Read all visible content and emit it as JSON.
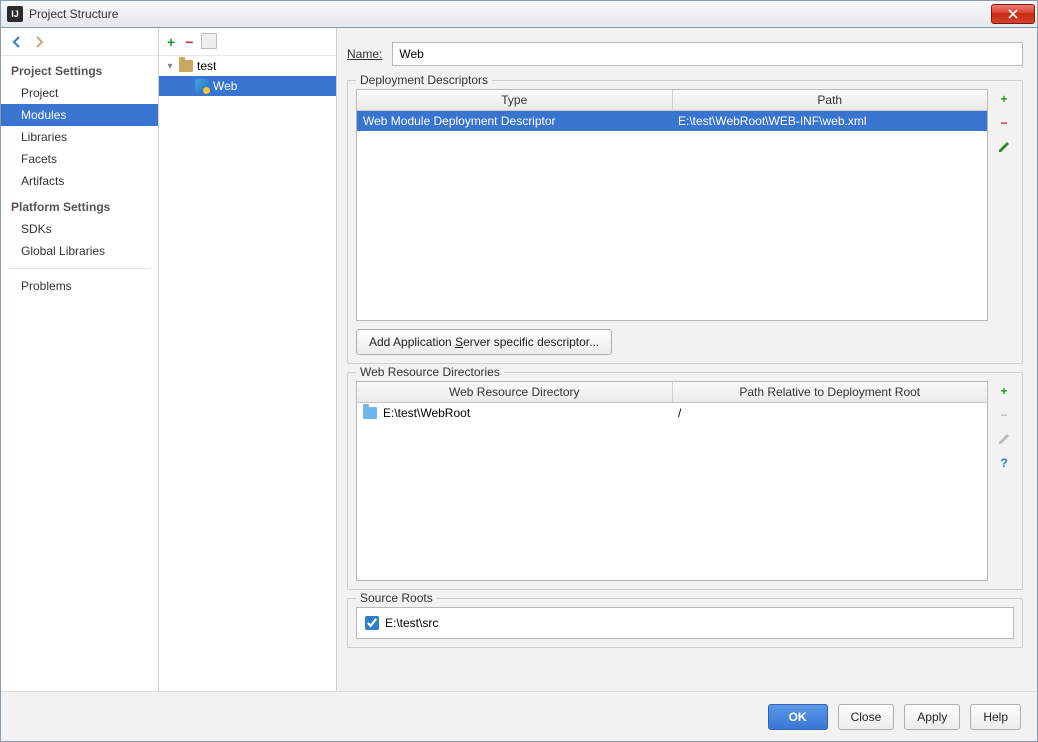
{
  "window": {
    "title": "Project Structure"
  },
  "nav": {
    "section1_title": "Project Settings",
    "section1_items": [
      "Project",
      "Modules",
      "Libraries",
      "Facets",
      "Artifacts"
    ],
    "section1_selected_index": 1,
    "section2_title": "Platform Settings",
    "section2_items": [
      "SDKs",
      "Global Libraries"
    ],
    "extra_items": [
      "Problems"
    ]
  },
  "tree": {
    "root": {
      "label": "test"
    },
    "child": {
      "label": "Web"
    }
  },
  "detail": {
    "name_label": "Name:",
    "name_value": "Web",
    "deploy": {
      "legend": "Deployment Descriptors",
      "headers": [
        "Type",
        "Path"
      ],
      "rows": [
        {
          "type": "Web Module Deployment Descriptor",
          "path": "E:\\test\\WebRoot\\WEB-INF\\web.xml",
          "selected": true
        }
      ],
      "add_button_prefix": "Add Application ",
      "add_button_u": "S",
      "add_button_suffix": "erver specific descriptor..."
    },
    "webres": {
      "legend": "Web Resource Directories",
      "headers": [
        "Web Resource Directory",
        "Path Relative to Deployment Root"
      ],
      "rows": [
        {
          "dir": "E:\\test\\WebRoot",
          "path": "/"
        }
      ]
    },
    "source": {
      "legend": "Source Roots",
      "items": [
        {
          "label": "E:\\test\\src",
          "checked": true
        }
      ]
    }
  },
  "footer": {
    "ok": "OK",
    "close": "Close",
    "apply": "Apply",
    "help": "Help"
  }
}
